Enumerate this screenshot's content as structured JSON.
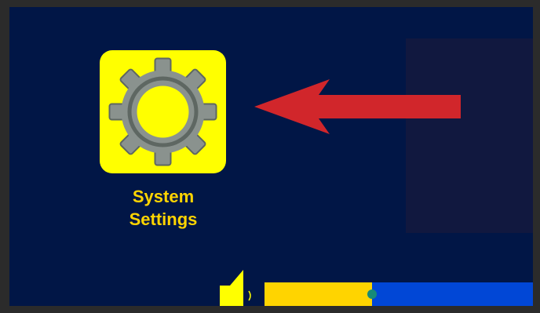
{
  "app_tile": {
    "label_line1": "System",
    "label_line2": "Settings",
    "icon": "gear-icon"
  },
  "hint": {
    "icon": "arrow-left-icon"
  },
  "volume": {
    "icon": "speaker-icon",
    "level_fraction": 0.4
  },
  "colors": {
    "background": "#011646",
    "side_panel": "#11183f",
    "tile": "#ffff00",
    "label": "#ffd400",
    "arrow": "#d1262b",
    "gear_body": "#8a928e",
    "gear_ring": "#5e6762",
    "slider_fill": "#ffd400",
    "slider_track": "#0147d6",
    "slider_knob": "#168a78"
  }
}
